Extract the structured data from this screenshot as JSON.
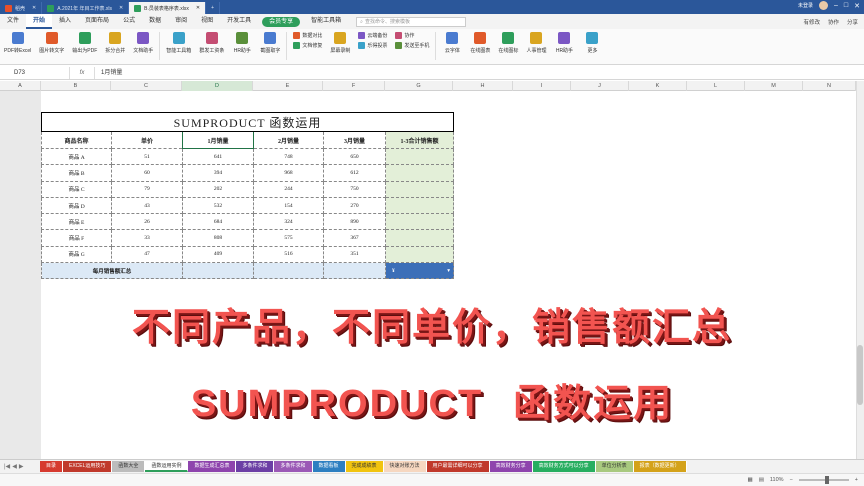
{
  "window_tabs": [
    {
      "label": "稻壳",
      "color": "#e8502a",
      "active": false
    },
    {
      "label": "A.2021年 年目工作表.xls",
      "color": "#2e9e5b",
      "active": false
    },
    {
      "label": "B.员装表格序表.xlsx",
      "color": "#2e9e5b",
      "active": true
    }
  ],
  "titlebar_right": {
    "label": "未登录"
  },
  "menu": {
    "file": "文件",
    "items": [
      "开始",
      "插入",
      "页面布局",
      "公式",
      "数据",
      "审阅",
      "视图",
      "开发工具"
    ],
    "member": "会员专享",
    "smart": "智能工具箱",
    "search_placeholder": "查找命令、搜索模板",
    "right": [
      "有修改",
      "协作",
      "分享"
    ]
  },
  "toolbar": {
    "big": [
      "PDF转Excel",
      "图片转文字",
      "输出为PDF",
      "拆分合并",
      "文档助手",
      "智能工具箱",
      "群发工资条",
      "HR助手",
      "截图取字"
    ],
    "small_a": [
      "数据对比",
      "文档修复"
    ],
    "big2": [
      "屏幕录制"
    ],
    "small_b": [
      "云端备份",
      "乐得投票"
    ],
    "small_c": [
      "协作",
      "发送至手机"
    ],
    "big3": [
      "云字体",
      "在线图表",
      "在线图标",
      "人事管理",
      "HR助手",
      "更多"
    ]
  },
  "formula_bar": {
    "cell_ref": "D73",
    "fx": "fx",
    "content": "1月销量"
  },
  "columns": [
    "A",
    "B",
    "C",
    "D",
    "E",
    "F",
    "G",
    "H",
    "I",
    "J",
    "K",
    "L",
    "M",
    "N"
  ],
  "table": {
    "title": "SUMPRODUCT 函数运用",
    "headers": [
      "商品名称",
      "单价",
      "1月销量",
      "2月销量",
      "3月销量",
      "1-3合计销售额"
    ],
    "rows": [
      {
        "name": "商品 A",
        "price": "51",
        "m1": "641",
        "m2": "748",
        "m3": "650"
      },
      {
        "name": "商品 B",
        "price": "60",
        "m1": "394",
        "m2": "968",
        "m3": "612"
      },
      {
        "name": "商品 C",
        "price": "79",
        "m1": "202",
        "m2": "244",
        "m3": "750"
      },
      {
        "name": "商品 D",
        "price": "43",
        "m1": "532",
        "m2": "154",
        "m3": "270"
      },
      {
        "name": "商品 E",
        "price": "26",
        "m1": "684",
        "m2": "324",
        "m3": "890"
      },
      {
        "name": "商品 F",
        "price": "33",
        "m1": "808",
        "m2": "575",
        "m3": "367"
      },
      {
        "name": "商品 G",
        "price": "47",
        "m1": "409",
        "m2": "516",
        "m3": "351"
      }
    ],
    "total_label": "每月销售额汇总",
    "total_value": "¥",
    "total_dropdown": "▾"
  },
  "overlay": {
    "line1": "不同产品，不同单价，销售额汇总",
    "line2a": "SUMPRODUCT",
    "line2b": "函数运用"
  },
  "sheet_tabs": [
    {
      "label": "目录",
      "color": "#d63a2f"
    },
    {
      "label": "EXCEL运用技巧",
      "color": "#c0392b"
    },
    {
      "label": "函数大全",
      "color": "#bcbcbc"
    },
    {
      "label": "函数运用实例",
      "color": "#ffffff"
    },
    {
      "label": "数据生成汇总表",
      "color": "#8e44ad"
    },
    {
      "label": "多条件求和",
      "color": "#6c3fa5"
    },
    {
      "label": "多条件求和",
      "color": "#9b59b6"
    },
    {
      "label": "数据看板",
      "color": "#2d7fc1"
    },
    {
      "label": "完成成绩表",
      "color": "#f1c40f"
    },
    {
      "label": "快速对账方法",
      "color": "#f6d7c0"
    },
    {
      "label": "用户最需详细可以分享",
      "color": "#c0392b"
    },
    {
      "label": "高效财务分享",
      "color": "#8e44ad"
    },
    {
      "label": "高效财务方式可以分享",
      "color": "#27ae60"
    },
    {
      "label": "单位分析表",
      "color": "#a8c97f"
    },
    {
      "label": "报表（数据更新）",
      "color": "#d4a21a"
    }
  ],
  "status": {
    "zoom": "110%"
  }
}
